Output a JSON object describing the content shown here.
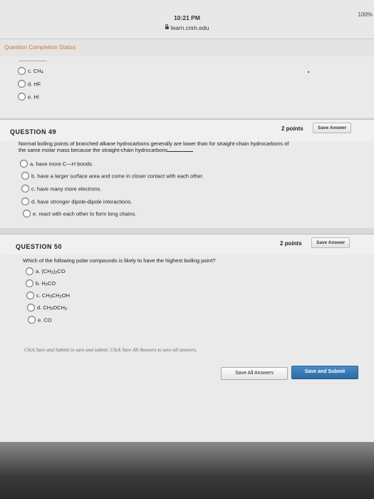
{
  "status_bar": {
    "time": "10:21 PM",
    "url": "learn.cnm.edu",
    "battery": "100%"
  },
  "completion": {
    "label": "Question Completion Status:"
  },
  "prev_question": {
    "options": [
      {
        "label": "c. CH4"
      },
      {
        "label": "d. HF"
      },
      {
        "label": "e. HI"
      }
    ]
  },
  "q49": {
    "title": "QUESTION 49",
    "points": "2 points",
    "save_label": "Save Answer",
    "text_line1": "Normal boiling points of branched alkane hydrocarbons generally are lower than for straight-chain hydrocarbons of",
    "text_line2": "the same molar mass because the straight-chain hydrocarbons",
    "options": [
      {
        "label": "a. have more C—H bonds."
      },
      {
        "label": "b. have a larger surface area and come in closer contact with each other."
      },
      {
        "label": "c. have many more electrons."
      },
      {
        "label": "d. have stronger dipole-dipole interactions."
      },
      {
        "label": "e. react with each other to form long chains."
      }
    ]
  },
  "q50": {
    "title": "QUESTION 50",
    "points": "2 points",
    "save_label": "Save Answer",
    "text": "Which of the following polar compounds is likely to have the highest boiling point?",
    "options": [
      {
        "label": "a. (CH3)2CO"
      },
      {
        "label": "b. H2CO"
      },
      {
        "label": "c. CH3CH2OH"
      },
      {
        "label": "d. CH3OCH3"
      },
      {
        "label": "e. CO"
      }
    ]
  },
  "footer": {
    "note": "Click Save and Submit to save and submit. Click Save All Answers to save all answers.",
    "save_all_label": "Save All Answers",
    "save_submit_label": "Save and Submit"
  }
}
